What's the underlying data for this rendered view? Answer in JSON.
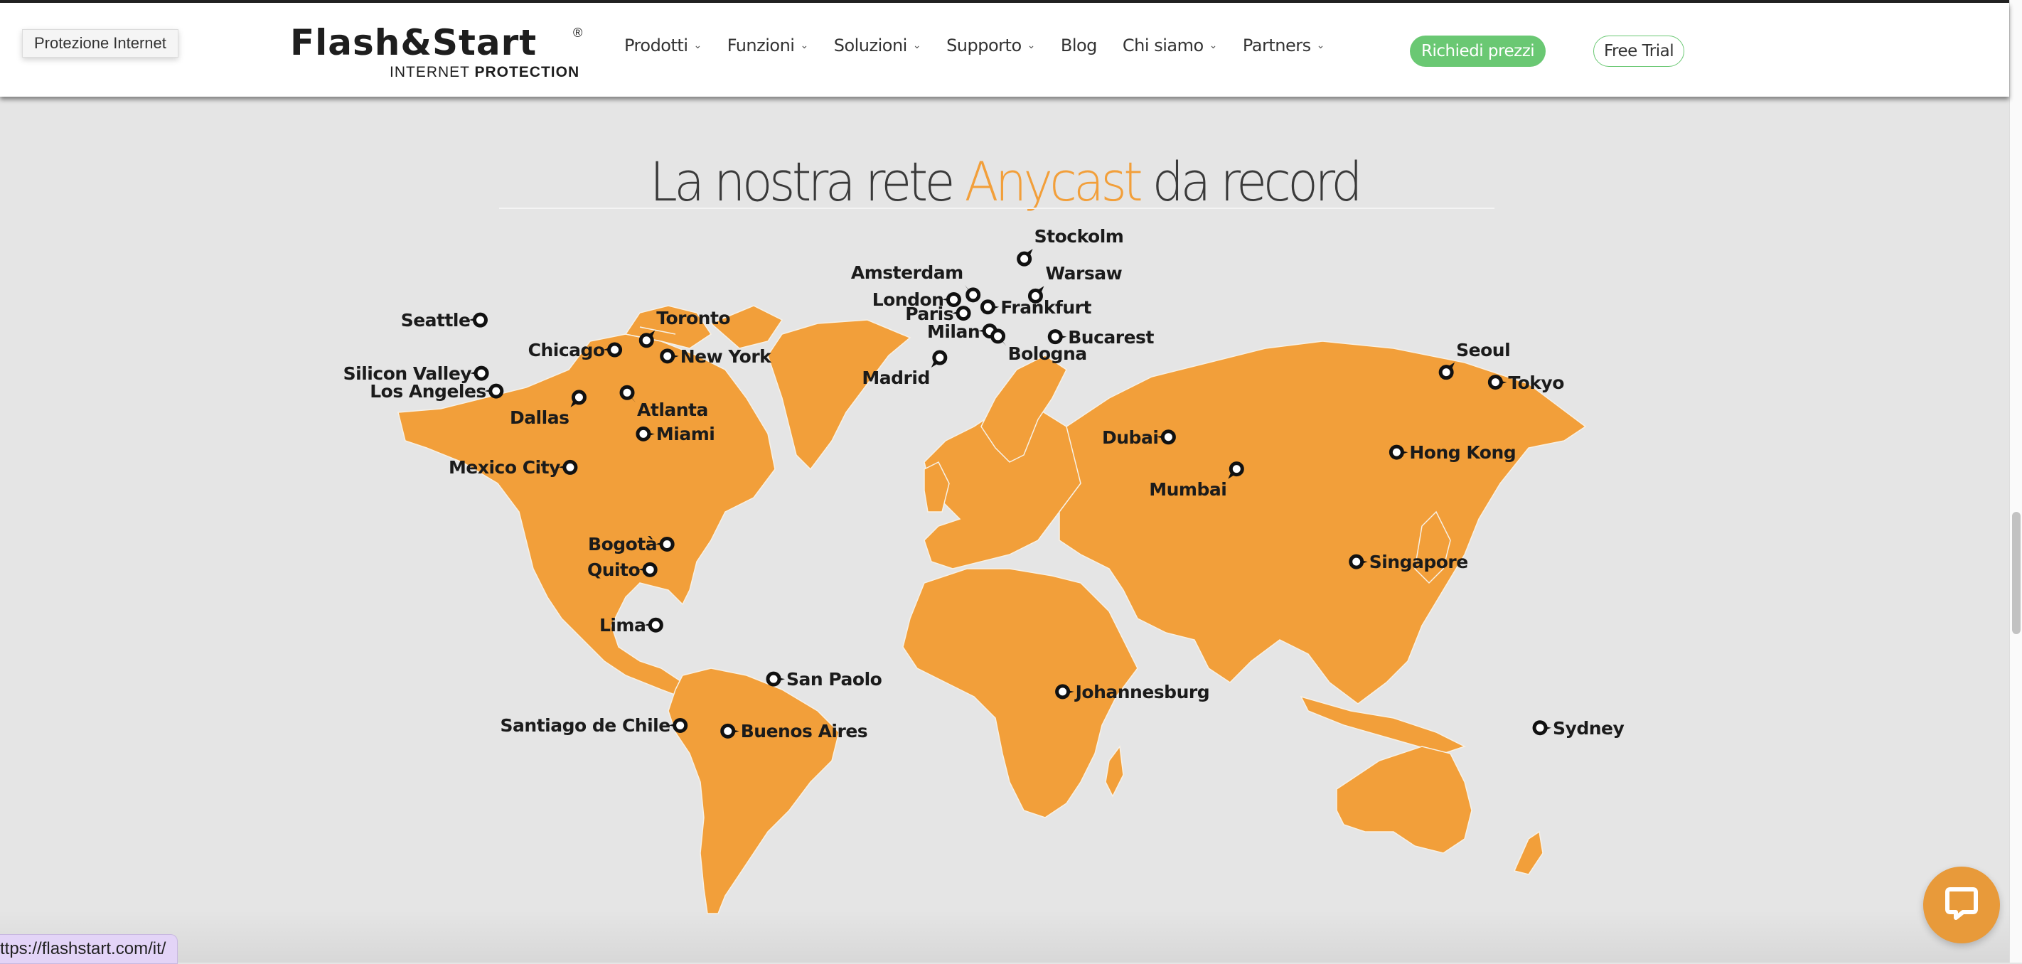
{
  "tooltip": "Protezione Internet",
  "logo": {
    "main": "Flash&Start",
    "registered": "®",
    "sub_light": "INTERNET",
    "sub_bold": "PROTECTION"
  },
  "nav": {
    "items": [
      {
        "label": "Prodotti",
        "has_dropdown": true
      },
      {
        "label": "Funzioni",
        "has_dropdown": true
      },
      {
        "label": "Soluzioni",
        "has_dropdown": true
      },
      {
        "label": "Supporto",
        "has_dropdown": true
      },
      {
        "label": "Blog",
        "has_dropdown": false
      },
      {
        "label": "Chi siamo",
        "has_dropdown": true
      },
      {
        "label": "Partners",
        "has_dropdown": true
      }
    ],
    "chevron": "⌄"
  },
  "buttons": {
    "request_prices": "Richiedi prezzi",
    "free_trial": "Free Trial"
  },
  "section": {
    "title_before": "La nostra rete ",
    "title_accent": "Anycast",
    "title_after": " da record"
  },
  "colors": {
    "accent_orange": "#f29f3a",
    "cta_green": "#6ac873",
    "background": "#e5e5e5",
    "land": "#f29f3a"
  },
  "map": {
    "icon": "pin-icon",
    "cities": [
      {
        "name": "Seattle",
        "lon": -122.3,
        "lat": 47.6,
        "label_side": "left"
      },
      {
        "name": "Silicon Valley",
        "lon": -122.0,
        "lat": 37.4,
        "label_side": "left"
      },
      {
        "name": "Los Angeles",
        "lon": -118.2,
        "lat": 34.0,
        "label_side": "left"
      },
      {
        "name": "Dallas",
        "lon": -96.8,
        "lat": 32.8,
        "label_side": "below-left"
      },
      {
        "name": "Mexico City",
        "lon": -99.1,
        "lat": 19.4,
        "label_side": "left"
      },
      {
        "name": "Chicago",
        "lon": -87.6,
        "lat": 41.9,
        "label_side": "left"
      },
      {
        "name": "Toronto",
        "lon": -79.4,
        "lat": 43.7,
        "label_side": "above-right"
      },
      {
        "name": "New York",
        "lon": -74.0,
        "lat": 40.7,
        "label_side": "right"
      },
      {
        "name": "Atlanta",
        "lon": -84.4,
        "lat": 33.7,
        "label_side": "below-right"
      },
      {
        "name": "Miami",
        "lon": -80.2,
        "lat": 25.8,
        "label_side": "right"
      },
      {
        "name": "Bogotà",
        "lon": -74.1,
        "lat": 4.7,
        "label_side": "left"
      },
      {
        "name": "Quito",
        "lon": -78.5,
        "lat": -0.2,
        "label_side": "left"
      },
      {
        "name": "Lima",
        "lon": -77.0,
        "lat": -12.0,
        "label_side": "left"
      },
      {
        "name": "San Paolo",
        "lon": -46.6,
        "lat": -23.5,
        "label_side": "right"
      },
      {
        "name": "Santiago de Chile",
        "lon": -70.7,
        "lat": -33.4,
        "label_side": "left"
      },
      {
        "name": "Buenos Aires",
        "lon": -58.4,
        "lat": -34.6,
        "label_side": "right"
      },
      {
        "name": "Amsterdam",
        "lon": 4.9,
        "lat": 52.4,
        "label_side": "above-left"
      },
      {
        "name": "London",
        "lon": -0.1,
        "lat": 51.5,
        "label_side": "left"
      },
      {
        "name": "Paris",
        "lon": 2.4,
        "lat": 48.9,
        "label_side": "left"
      },
      {
        "name": "Madrid",
        "lon": -3.7,
        "lat": 40.4,
        "label_side": "below-left"
      },
      {
        "name": "Stockolm",
        "lon": 18.1,
        "lat": 59.3,
        "label_side": "above-right"
      },
      {
        "name": "Warsaw",
        "lon": 21.0,
        "lat": 52.2,
        "label_side": "above-right"
      },
      {
        "name": "Frankfurt",
        "lon": 8.7,
        "lat": 50.1,
        "label_side": "right"
      },
      {
        "name": "Milan",
        "lon": 9.2,
        "lat": 45.5,
        "label_side": "left"
      },
      {
        "name": "Bologna",
        "lon": 11.3,
        "lat": 44.5,
        "label_side": "below-right"
      },
      {
        "name": "Bucarest",
        "lon": 26.1,
        "lat": 44.4,
        "label_side": "right"
      },
      {
        "name": "Dubai",
        "lon": 55.3,
        "lat": 25.2,
        "label_side": "left"
      },
      {
        "name": "Mumbai",
        "lon": 72.9,
        "lat": 19.1,
        "label_side": "below-left"
      },
      {
        "name": "Johannesburg",
        "lon": 28.0,
        "lat": -26.2,
        "label_side": "right"
      },
      {
        "name": "Seoul",
        "lon": 127.0,
        "lat": 37.6,
        "label_side": "above-right"
      },
      {
        "name": "Tokyo",
        "lon": 139.7,
        "lat": 35.7,
        "label_side": "right"
      },
      {
        "name": "Hong Kong",
        "lon": 114.2,
        "lat": 22.3,
        "label_side": "right"
      },
      {
        "name": "Singapore",
        "lon": 103.8,
        "lat": 1.35,
        "label_side": "right"
      },
      {
        "name": "Sydney",
        "lon": 151.2,
        "lat": -33.9,
        "label_side": "right"
      }
    ]
  },
  "status_bar": {
    "url": "ttps://flashstart.com/it/"
  },
  "chat": {
    "icon": "chat-bubble-icon"
  }
}
